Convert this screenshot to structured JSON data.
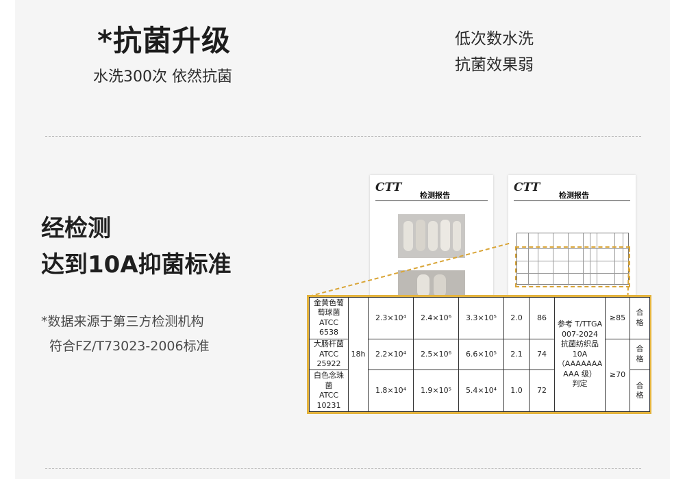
{
  "top": {
    "title": "*抗菌升级",
    "subtitle": "水洗300次 依然抗菌",
    "compare_lines": [
      "低次数水洗",
      "抗菌效果弱"
    ]
  },
  "middle": {
    "headline_lines": [
      "经检测",
      "达到10A抑菌标准"
    ],
    "note_lines": [
      "*数据来源于第三方检测机构",
      "符合FZ/T73023-2006标准"
    ]
  },
  "reports": {
    "logo": "CTT",
    "title": "检测报告"
  },
  "table": {
    "time": "18h",
    "rows": [
      {
        "strain": [
          "金黄色葡",
          "萄球菌",
          "ATCC",
          "6538"
        ],
        "v1": "2.3×10⁴",
        "v2": "2.4×10⁶",
        "v3": "3.3×10⁵",
        "v4": "2.0",
        "v5": "86",
        "result": [
          "合",
          "格"
        ]
      },
      {
        "strain": [
          "大肠杆菌",
          "ATCC",
          "25922"
        ],
        "v1": "2.2×10⁴",
        "v2": "2.5×10⁶",
        "v3": "6.6×10⁵",
        "v4": "2.1",
        "v5": "74",
        "result": [
          "合",
          "格"
        ]
      },
      {
        "strain": [
          "白色念珠",
          "菌",
          "ATCC",
          "10231"
        ],
        "v1": "1.8×10⁴",
        "v2": "1.9×10⁵",
        "v3": "5.4×10⁴",
        "v4": "1.0",
        "v5": "72",
        "result": [
          "合",
          "格"
        ]
      }
    ],
    "standard": [
      "参考 T/TTGA",
      "007-2024",
      "抗菌纺织品",
      "10A",
      "（AAAAAAA",
      "AAA 级）",
      "判定"
    ],
    "threshold_1": "≥85",
    "threshold_2": "≥70"
  },
  "colors": {
    "accent": "#e2b23c",
    "panel_bg": "#f5f5f5",
    "logo_red": "#c62828"
  }
}
